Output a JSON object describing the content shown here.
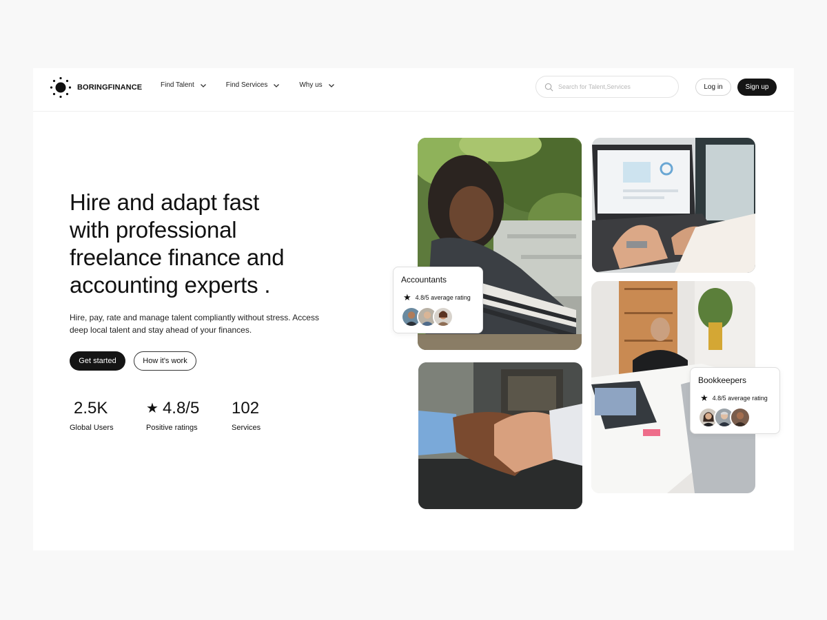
{
  "brand": {
    "name": "BORINGFINANCE",
    "icon": "sun-logo-icon"
  },
  "nav": {
    "items": [
      {
        "label": "Find Talent"
      },
      {
        "label": "Find Services"
      },
      {
        "label": "Why us"
      }
    ]
  },
  "search": {
    "placeholder": "Search for Talent,Services",
    "value": ""
  },
  "auth": {
    "login_label": "Log in",
    "signup_label": "Sign up"
  },
  "hero": {
    "title_lines": [
      "Hire and adapt fast",
      "with professional",
      "freelance finance and",
      "accounting experts ."
    ],
    "subtitle_lines": [
      "Hire, pay, rate and manage talent  compliantly without stress. Access",
      "deep local  talent and stay ahead of your finances."
    ],
    "primary_cta": "Get started",
    "secondary_cta": "How it's work"
  },
  "stats": [
    {
      "value": "2.5K",
      "label": "Global Users"
    },
    {
      "value": "4.8/5",
      "label": "Positive ratings"
    },
    {
      "value": "102",
      "label": "Services"
    }
  ],
  "cards": {
    "accountants": {
      "title": "Accountants",
      "rating": "4.8/5 average rating"
    },
    "bookkeepers": {
      "title": "Bookkeepers",
      "rating": "4.8/5 average rating"
    }
  },
  "colors": {
    "primary": "#151515",
    "background": "#f8f8f8",
    "surface": "#ffffff",
    "border": "#dedede"
  }
}
